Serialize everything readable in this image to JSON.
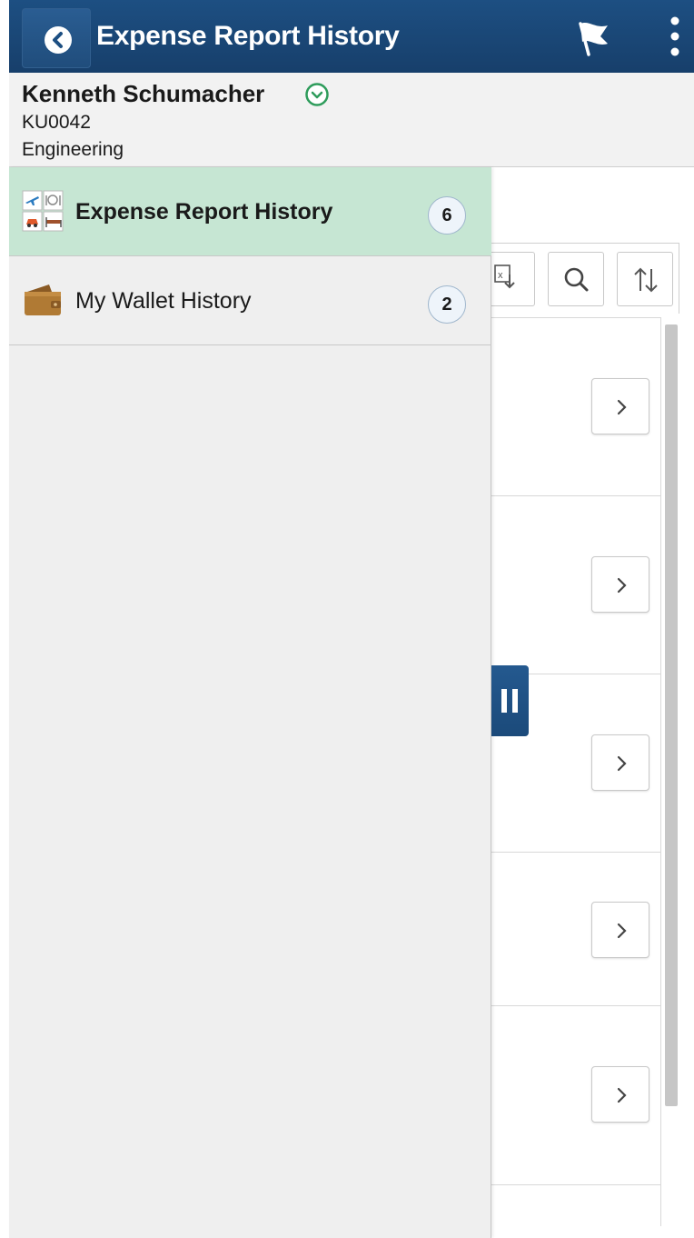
{
  "header": {
    "title": "Expense Report History",
    "back_icon": "chevron-left-icon",
    "flag_icon": "flag-icon",
    "menu_icon": "kebab-menu-icon",
    "background_color": "#1d4f82"
  },
  "person": {
    "name": "Kenneth Schumacher",
    "id": "KU0042",
    "department": "Engineering",
    "expand_icon": "chevron-down-circle-icon",
    "expand_icon_color": "#2e9c5b"
  },
  "drawer": {
    "items": [
      {
        "label": "Expense Report History",
        "count": "6",
        "icon": "expense-report-icon",
        "selected": true,
        "selected_color": "#c6e6d3"
      },
      {
        "label": "My Wallet History",
        "count": "2",
        "icon": "wallet-icon",
        "selected": false
      }
    ]
  },
  "toolbar": {
    "export_icon": "excel-export-icon",
    "search_icon": "search-icon",
    "sort_icon": "sort-icon"
  },
  "list": {
    "row_action_icon": "chevron-right-icon"
  },
  "handle": {
    "icon": "pause-bars-icon"
  }
}
